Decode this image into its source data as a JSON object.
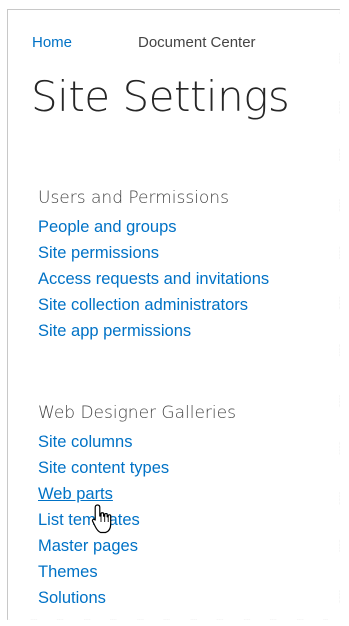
{
  "nav": {
    "home_label": "Home",
    "doc_center_label": "Document Center"
  },
  "page_title": "Site Settings",
  "users_section": {
    "heading": "Users and Permissions",
    "links": [
      {
        "label": "People and groups"
      },
      {
        "label": "Site permissions"
      },
      {
        "label": "Access requests and invitations"
      },
      {
        "label": "Site collection administrators"
      },
      {
        "label": "Site app permissions"
      }
    ]
  },
  "galleries_section": {
    "heading": "Web Designer Galleries",
    "links": [
      {
        "label": "Site columns"
      },
      {
        "label": "Site content types"
      },
      {
        "label": "Web parts",
        "state": "hover"
      },
      {
        "label": "List templates"
      },
      {
        "label": "Master pages"
      },
      {
        "label": "Themes"
      },
      {
        "label": "Solutions"
      }
    ]
  },
  "colors": {
    "link": "#0072c6",
    "heading": "#444444",
    "title": "#262626"
  },
  "cursor_icon": "hand-pointer-icon"
}
